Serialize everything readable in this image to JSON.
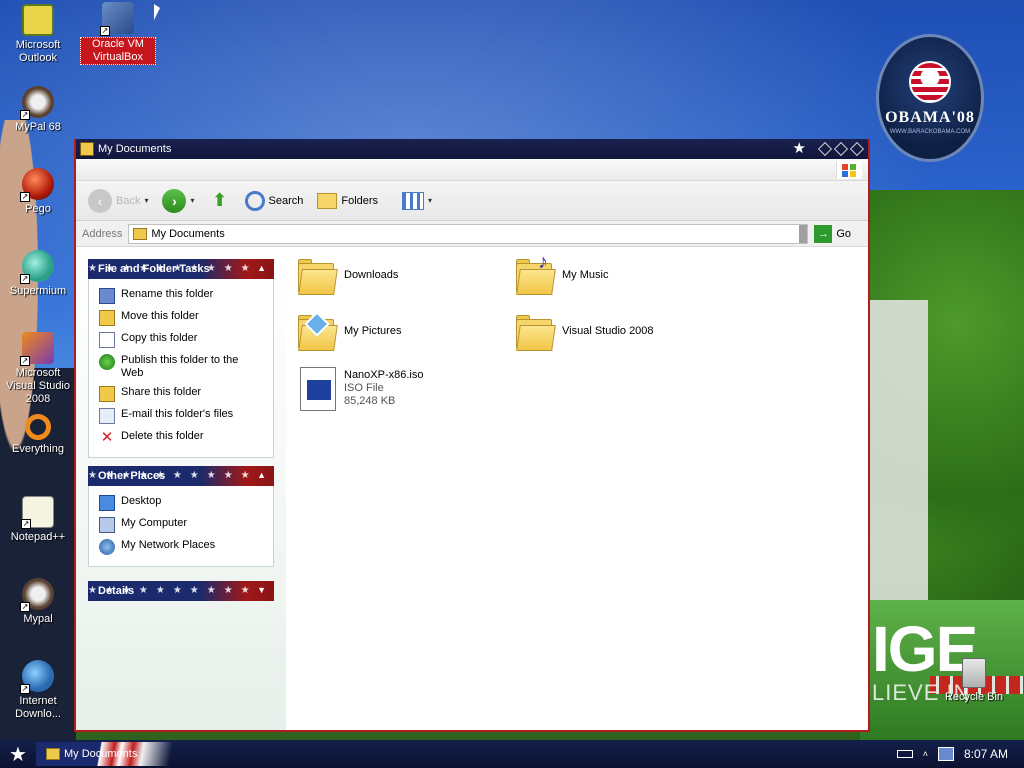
{
  "desktop": {
    "icons": [
      {
        "label": "Microsoft Outlook",
        "icon": "outlook-icon"
      },
      {
        "label": "Oracle VM VirtualBox",
        "icon": "virtualbox-icon"
      },
      {
        "label": "MyPal 68",
        "icon": "mypal-icon"
      },
      {
        "label": "Pego",
        "icon": "pego-icon"
      },
      {
        "label": "Supermium",
        "icon": "supermium-icon"
      },
      {
        "label": "Microsoft Visual Studio 2008",
        "icon": "visual-studio-icon"
      },
      {
        "label": "Everything",
        "icon": "everything-icon"
      },
      {
        "label": "Notepad++",
        "icon": "notepad-plus-icon"
      },
      {
        "label": "Mypal",
        "icon": "mypal-icon"
      },
      {
        "label": "Internet Downlo...",
        "icon": "internet-download-icon"
      },
      {
        "label": "Recycle Bin",
        "icon": "recycle-bin-icon"
      }
    ],
    "badge": {
      "text": "OBAMA'08",
      "sub": "WWW.BARACKOBAMA.COM"
    },
    "wallpaper_text": {
      "main": "IGE",
      "sub": "LIEVE IN"
    }
  },
  "window": {
    "title": "My Documents",
    "toolbar": {
      "back_label": "Back",
      "search_label": "Search",
      "folders_label": "Folders"
    },
    "address": {
      "label": "Address",
      "value": "My Documents",
      "go_label": "Go"
    },
    "panels": {
      "file_tasks": {
        "title": "File and Folder Tasks",
        "items": [
          {
            "label": "Rename this folder",
            "icon": "rename-icon"
          },
          {
            "label": "Move this folder",
            "icon": "move-icon"
          },
          {
            "label": "Copy this folder",
            "icon": "copy-icon"
          },
          {
            "label": "Publish this folder to the Web",
            "icon": "publish-web-icon"
          },
          {
            "label": "Share this folder",
            "icon": "share-icon"
          },
          {
            "label": "E-mail this folder's files",
            "icon": "email-icon"
          },
          {
            "label": "Delete this folder",
            "icon": "delete-icon"
          }
        ]
      },
      "other_places": {
        "title": "Other Places",
        "items": [
          {
            "label": "Desktop",
            "icon": "desktop-icon"
          },
          {
            "label": "My Computer",
            "icon": "my-computer-icon"
          },
          {
            "label": "My Network Places",
            "icon": "network-places-icon"
          }
        ]
      },
      "details": {
        "title": "Details"
      }
    },
    "files": [
      {
        "name": "Downloads",
        "type": "folder"
      },
      {
        "name": "My Music",
        "type": "music-folder"
      },
      {
        "name": "My Pictures",
        "type": "pictures-folder"
      },
      {
        "name": "Visual Studio 2008",
        "type": "folder"
      },
      {
        "name": "NanoXP-x86.iso",
        "line2": "ISO File",
        "line3": "85,248 KB",
        "type": "iso"
      }
    ]
  },
  "taskbar": {
    "task_label": "My Documents",
    "clock": "8:07 AM"
  },
  "colors": {
    "title_bar": "#1b2150",
    "panel_blue": "#1a2a6c",
    "panel_red": "#a01818",
    "window_border": "#b21c1c"
  }
}
